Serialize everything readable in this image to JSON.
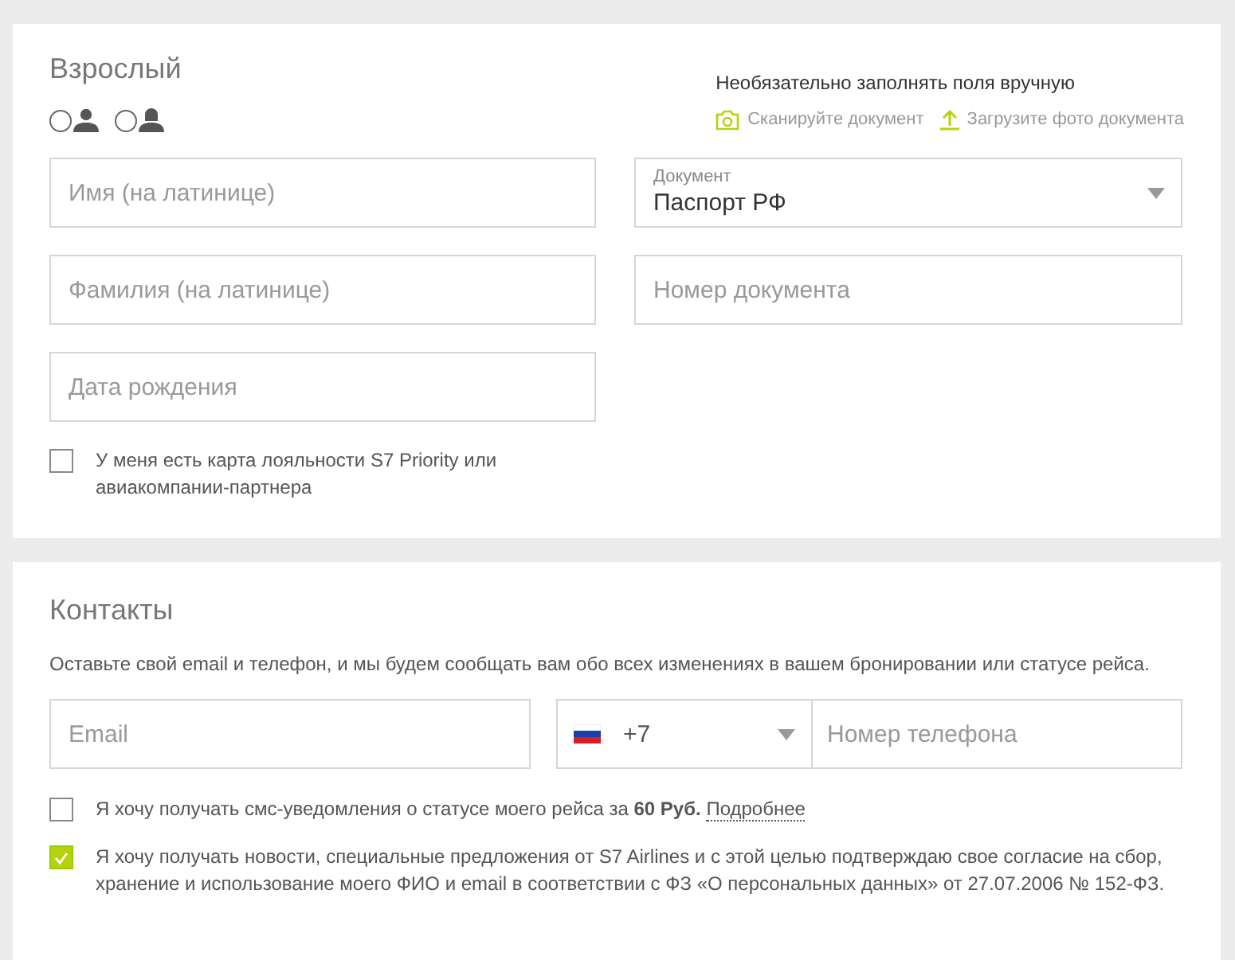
{
  "passenger": {
    "title": "Взрослый",
    "manual_note": "Необязательно заполнять поля вручную",
    "doc_actions": [
      {
        "kind": "camera",
        "label": "Сканируйте документ"
      },
      {
        "kind": "upload",
        "label": "Загрузите фото документа"
      }
    ],
    "gender_options": [
      {
        "kind": "male",
        "selected": false
      },
      {
        "kind": "female",
        "selected": false
      }
    ],
    "first_name": {
      "placeholder": "Имя (на латинице)"
    },
    "last_name": {
      "placeholder": "Фамилия (на латинице)"
    },
    "birth_date": {
      "placeholder": "Дата рождения"
    },
    "document": {
      "label": "Документ",
      "value": "Паспорт РФ"
    },
    "document_number": {
      "placeholder": "Номер документа"
    },
    "loyalty": {
      "checked": false,
      "label": "У меня есть карта лояльности S7 Priority или авиакомпании-партнера"
    }
  },
  "contacts": {
    "title": "Контакты",
    "description": "Оставьте свой email и телефон, и мы будем сообщать вам обо всех изменениях в вашем бронировании или статусе рейса.",
    "email": {
      "placeholder": "Email"
    },
    "country_code": "+7",
    "phone": {
      "placeholder": "Номер телефона"
    },
    "consents": [
      {
        "checked": false,
        "text": "Я хочу получать смс-уведомления о статусе моего рейса за **60 Руб.**",
        "link": "Подробнее"
      },
      {
        "checked": true,
        "text": "Я хочу получать новости, специальные предложения от S7 Airlines и с этой целью подтверждаю свое согласие на сбор, хранение и использование моего ФИО и email в соответствии с ФЗ «О персональных данных» от 27.07.2006 № 152-ФЗ."
      }
    ]
  }
}
